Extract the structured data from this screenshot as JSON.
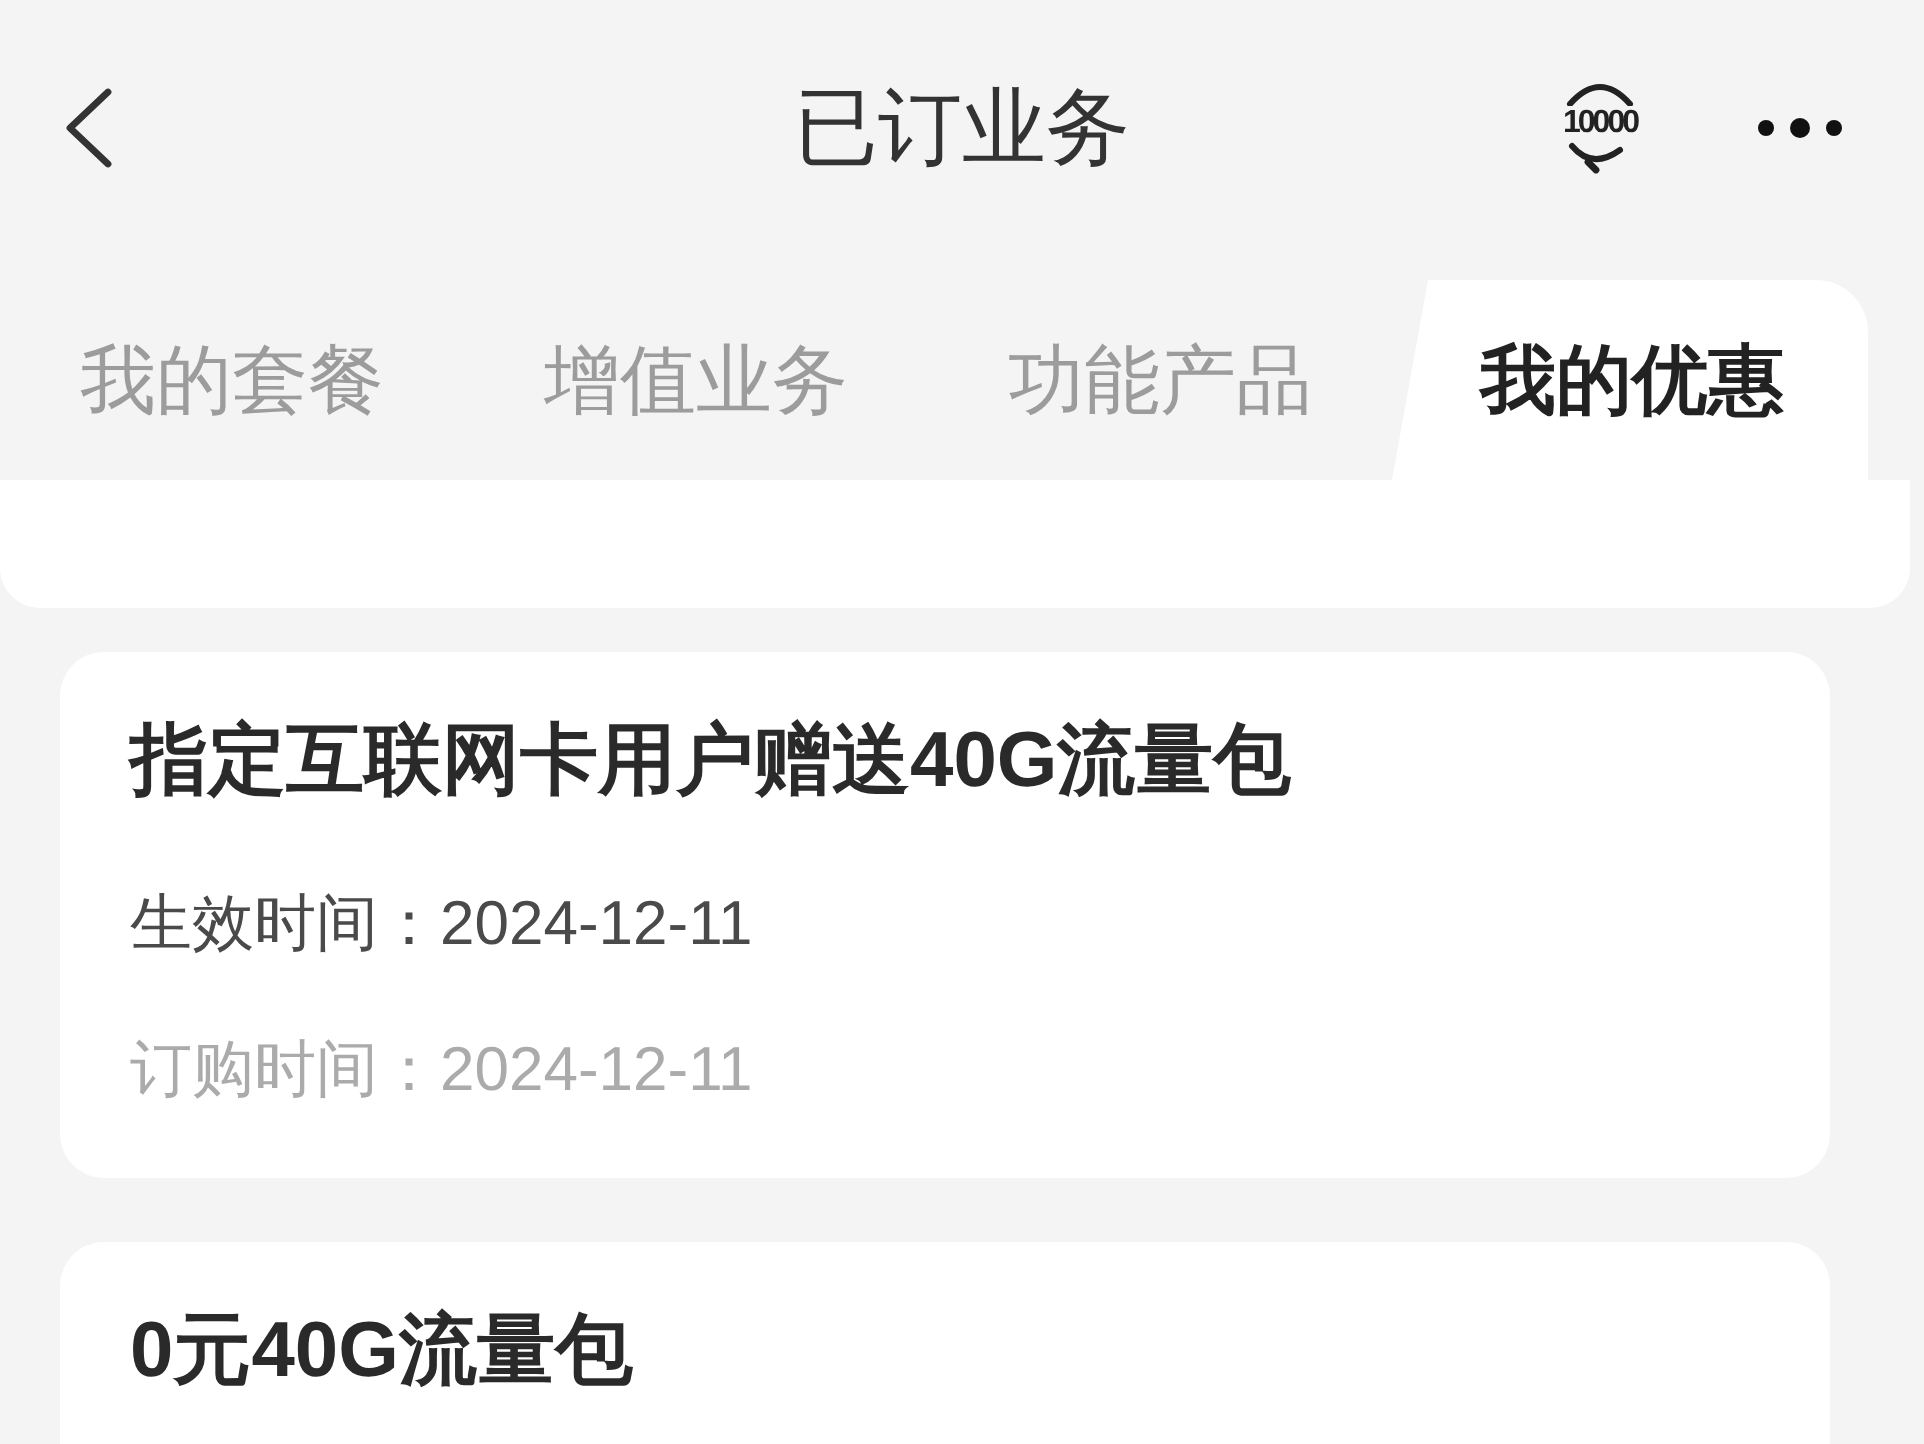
{
  "header": {
    "title": "已订业务",
    "hotline_label": "10000"
  },
  "tabs": [
    {
      "label": "我的套餐",
      "selected": false
    },
    {
      "label": "增值业务",
      "selected": false
    },
    {
      "label": "功能产品",
      "selected": false
    },
    {
      "label": "我的优惠",
      "selected": true
    }
  ],
  "offers": [
    {
      "name": "指定互联网卡用户赠送40G流量包",
      "fields": [
        {
          "kind": "normal",
          "text": "生效时间：2024-12-11"
        },
        {
          "kind": "faded",
          "text": "订购时间：2024-12-11"
        }
      ]
    },
    {
      "name": "0元40G流量包"
    }
  ]
}
